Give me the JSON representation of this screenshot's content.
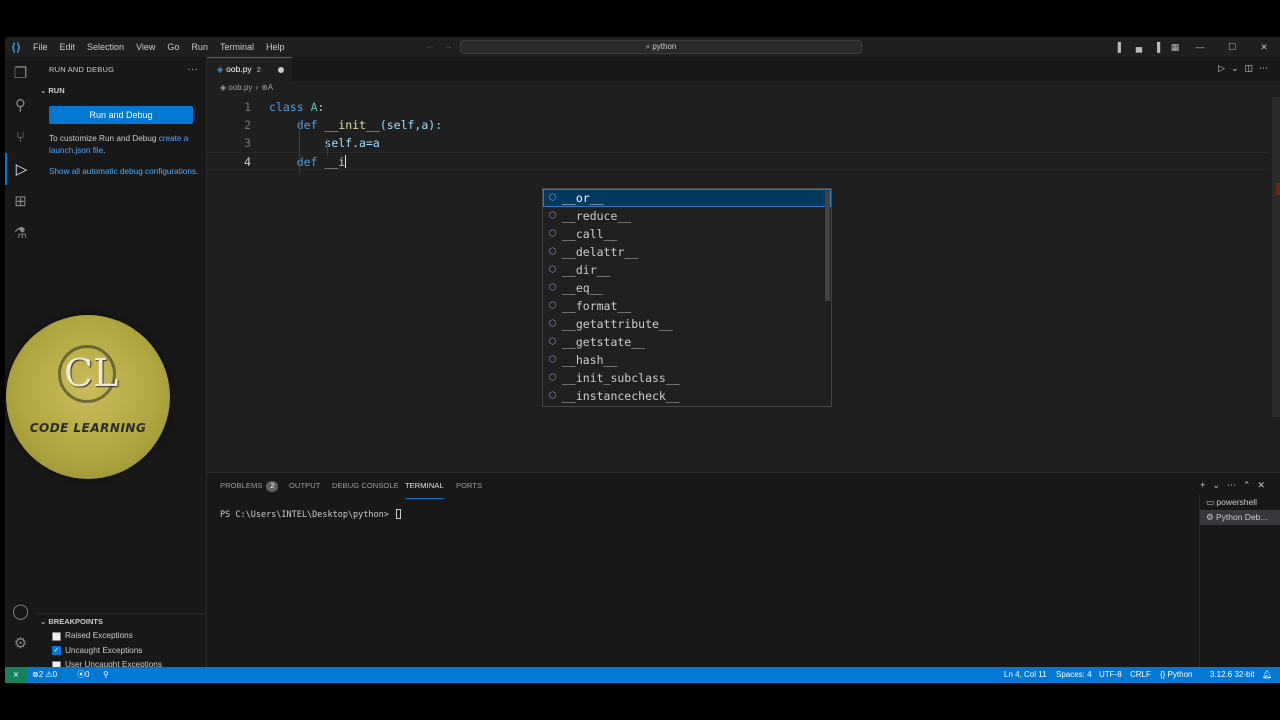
{
  "menu": [
    "File",
    "Edit",
    "Selection",
    "View",
    "Go",
    "Run",
    "Terminal",
    "Help"
  ],
  "search": {
    "text": "python"
  },
  "sidebar": {
    "title": "RUN AND DEBUG",
    "section": "RUN",
    "run_button": "Run and Debug",
    "customize_text": "To customize Run and Debug ",
    "customize_link": "create a launch.json file",
    "customize_end": ".",
    "show_all_link": "Show all automatic debug configurations",
    "show_all_end": "."
  },
  "breakpoints": {
    "title": "BREAKPOINTS",
    "items": [
      {
        "label": "Raised Exceptions",
        "checked": false
      },
      {
        "label": "Uncaught Exceptions",
        "checked": true
      },
      {
        "label": "User Uncaught Exceptions",
        "checked": false
      }
    ]
  },
  "brand": {
    "letters": "CL",
    "text": "CODE LEARNING"
  },
  "editor": {
    "tab": {
      "name": "oob.py",
      "problems": "2"
    },
    "breadcrumb": {
      "file": "oob.py",
      "symbol": "A"
    },
    "lines": [
      "1",
      "2",
      "3",
      "4"
    ],
    "code": {
      "l1_kw": "class",
      "l1_name": "A",
      "l1_end": ":",
      "l2_kw": "def",
      "l2_fn": "__init__",
      "l2_args": "(self,a):",
      "l3_text": "self.a=a",
      "l4_kw": "def",
      "l4_typed": "__i"
    }
  },
  "suggest": {
    "items": [
      "__or__",
      "__reduce__",
      "__call__",
      "__delattr__",
      "__dir__",
      "__eq__",
      "__format__",
      "__getattribute__",
      "__getstate__",
      "__hash__",
      "__init_subclass__",
      "__instancecheck__"
    ]
  },
  "panel": {
    "tabs": {
      "problems": "PROBLEMS",
      "problems_count": "2",
      "output": "OUTPUT",
      "debug_console": "DEBUG CONSOLE",
      "terminal": "TERMINAL",
      "ports": "PORTS"
    },
    "prompt": "PS C:\\Users\\INTEL\\Desktop\\python> ",
    "terminals": [
      "powershell",
      "Python Deb..."
    ]
  },
  "status": {
    "errors": "2",
    "warnings": "0",
    "ports": "0",
    "position": "Ln 4, Col 11",
    "spaces": "Spaces: 4",
    "encoding": "UTF-8",
    "eol": "CRLF",
    "language": "Python",
    "interpreter": "3.12.6 32-bit"
  }
}
